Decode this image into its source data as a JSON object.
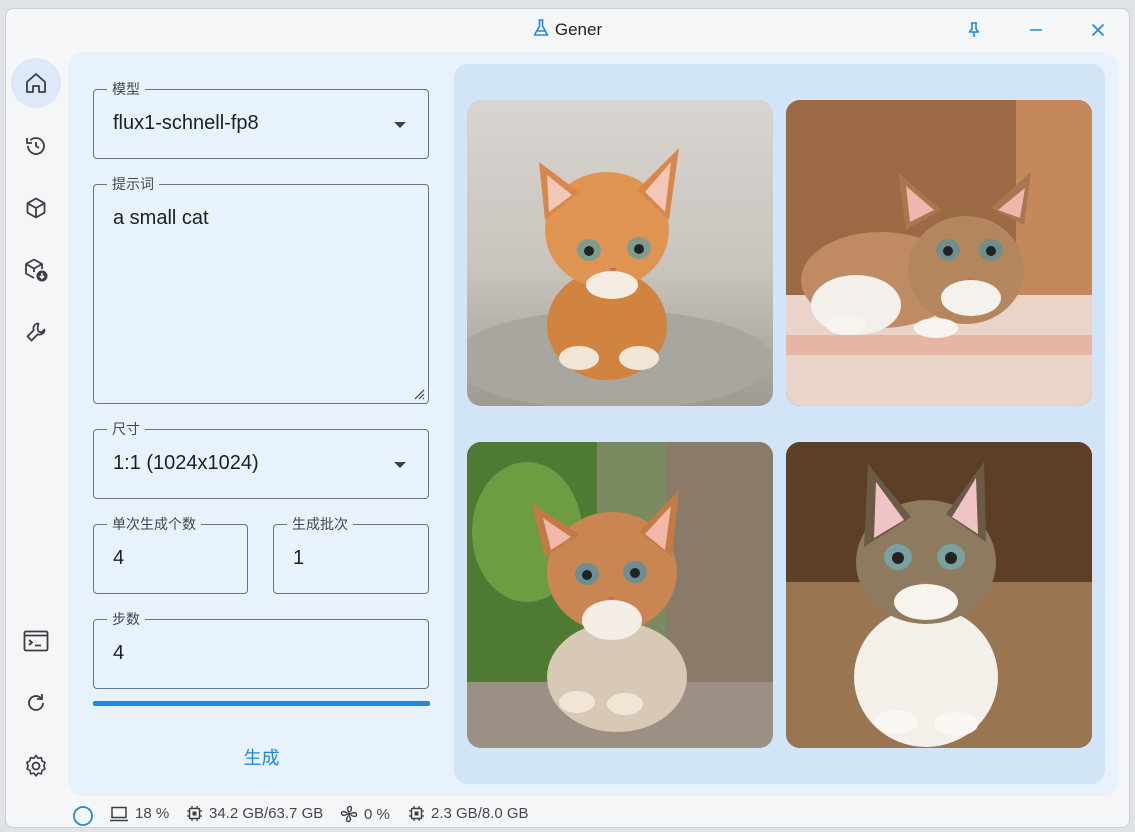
{
  "window": {
    "title": "Gener",
    "icon": "flask-icon"
  },
  "titlebar_buttons": [
    "pin-icon",
    "minimize-icon",
    "close-icon"
  ],
  "nav": {
    "items": [
      {
        "id": "home",
        "icon": "home-icon",
        "active": true
      },
      {
        "id": "history",
        "icon": "history-icon",
        "active": false
      },
      {
        "id": "models",
        "icon": "cube-icon",
        "active": false
      },
      {
        "id": "model-download",
        "icon": "cube-download-icon",
        "active": false
      },
      {
        "id": "tools",
        "icon": "wrench-icon",
        "active": false
      },
      {
        "id": "terminal",
        "icon": "terminal-icon",
        "active": false
      },
      {
        "id": "refresh",
        "icon": "refresh-icon",
        "active": false
      },
      {
        "id": "settings",
        "icon": "gear-icon",
        "active": false
      }
    ]
  },
  "form": {
    "model": {
      "label": "模型",
      "value": "flux1-schnell-fp8"
    },
    "prompt": {
      "label": "提示词",
      "value": "a small cat"
    },
    "size": {
      "label": "尺寸",
      "value": "1:1 (1024x1024)"
    },
    "batch_size": {
      "label": "单次生成个数",
      "value": "4"
    },
    "batch_count": {
      "label": "生成批次",
      "value": "1"
    },
    "steps": {
      "label": "步数",
      "value": "4"
    },
    "progress": 1.0,
    "generate_label": "生成"
  },
  "gallery": {
    "images": [
      {
        "description": "orange tabby kitten on grey pavement",
        "palette": [
          "#c8c3bd",
          "#d58a4a",
          "#9a9690"
        ]
      },
      {
        "description": "tabby and white kitten crouching on rug",
        "palette": [
          "#8a5a3a",
          "#e0a07a",
          "#e9c4b8"
        ]
      },
      {
        "description": "tabby kitten sitting near green leaves",
        "palette": [
          "#5a8a3a",
          "#c98552",
          "#9d8f80"
        ]
      },
      {
        "description": "tabby and white kitten on wooden floor",
        "palette": [
          "#6b4a2e",
          "#8a6a4a",
          "#b89a78"
        ]
      }
    ]
  },
  "status": {
    "indicator": "circle-icon",
    "cpu": "18 %",
    "ram": "34.2 GB/63.7 GB",
    "gpu": "0 %",
    "vram": "2.3 GB/8.0 GB"
  },
  "colors": {
    "accent": "#1e88e5",
    "panel": "#e8f2fd",
    "gallery_bg": "#d2e4f7"
  }
}
